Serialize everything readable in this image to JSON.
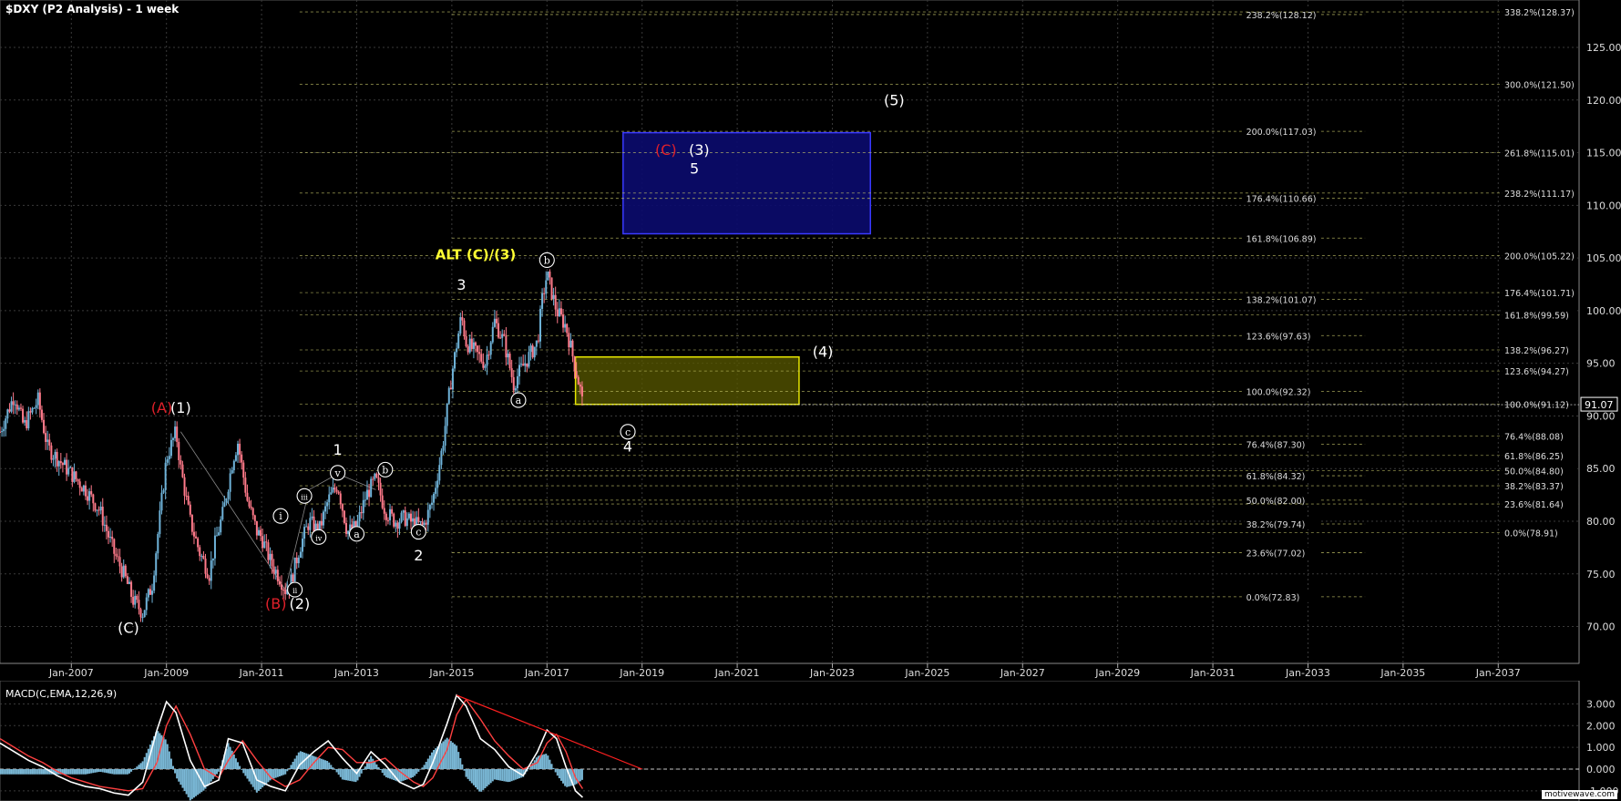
{
  "title": "$DXY (P2 Analysis) - 1 week",
  "macd_title": "MACD(C,EMA,12,26,9)",
  "watermark": "motivewave.com",
  "colors": {
    "background": "#000000",
    "grid": "#3a3a3a",
    "candle_up": "#6fb3d9",
    "candle_down": "#ff7a8a",
    "fib_line": "#c8c86a",
    "fib_label_bg": "#000000",
    "blue_box": "#0b0b6e",
    "blue_border": "#3a3aff",
    "yellow_box": "#5a5a00",
    "yellow_border": "#e6e600",
    "red_label": "#e0202a",
    "yellow_label": "#ffff33",
    "macd_line": "#ffffff",
    "signal_line": "#ff4040",
    "histogram": "#7ab8d6",
    "trendline": "#ff2020"
  },
  "chart_data": [
    {
      "type": "candlestick",
      "title": "$DXY (P2 Analysis) - 1 week",
      "x_ticks": [
        "Jan-2007",
        "Jan-2009",
        "Jan-2011",
        "Jan-2013",
        "Jan-2015",
        "Jan-2017",
        "Jan-2019",
        "Jan-2021",
        "Jan-2023",
        "Jan-2025",
        "Jan-2027",
        "Jan-2029",
        "Jan-2031",
        "Jan-2033",
        "Jan-2035",
        "Jan-2037"
      ],
      "x_range": [
        2005.5,
        2038.7
      ],
      "y_ticks": [
        70,
        75,
        80,
        85,
        90,
        95,
        100,
        105,
        110,
        115,
        120,
        125
      ],
      "y_tick_labels": [
        "70.00",
        "75.00",
        "80.00",
        "85.00",
        "90.00",
        "95.00",
        "100.00",
        "105.00",
        "110.00",
        "115.00",
        "120.00",
        "125.00"
      ],
      "y_range": [
        66.5,
        129.5
      ],
      "current_price": "91.07",
      "price_path": [
        [
          2005.5,
          88.5
        ],
        [
          2005.8,
          92
        ],
        [
          2006.0,
          89
        ],
        [
          2006.3,
          91.5
        ],
        [
          2006.5,
          87
        ],
        [
          2006.8,
          85.5
        ],
        [
          2007.0,
          84.5
        ],
        [
          2007.3,
          83
        ],
        [
          2007.6,
          81
        ],
        [
          2007.9,
          77
        ],
        [
          2008.1,
          75
        ],
        [
          2008.3,
          72.5
        ],
        [
          2008.5,
          71.3
        ],
        [
          2008.7,
          74
        ],
        [
          2008.9,
          82
        ],
        [
          2009.0,
          86
        ],
        [
          2009.2,
          88.5
        ],
        [
          2009.3,
          85
        ],
        [
          2009.5,
          80
        ],
        [
          2009.7,
          77
        ],
        [
          2009.9,
          75
        ],
        [
          2010.0,
          77.5
        ],
        [
          2010.2,
          81
        ],
        [
          2010.4,
          86
        ],
        [
          2010.5,
          87.5
        ],
        [
          2010.7,
          82
        ],
        [
          2010.9,
          79
        ],
        [
          2011.0,
          78.5
        ],
        [
          2011.2,
          76
        ],
        [
          2011.4,
          74.5
        ],
        [
          2011.5,
          73.5
        ],
        [
          2011.6,
          74
        ],
        [
          2011.8,
          77.5
        ],
        [
          2012.0,
          80
        ],
        [
          2012.2,
          79
        ],
        [
          2012.4,
          82
        ],
        [
          2012.6,
          83.5
        ],
        [
          2012.8,
          79
        ],
        [
          2013.0,
          79.5
        ],
        [
          2013.2,
          82.5
        ],
        [
          2013.4,
          84
        ],
        [
          2013.6,
          81
        ],
        [
          2013.8,
          80
        ],
        [
          2014.0,
          80.3
        ],
        [
          2014.2,
          79.8
        ],
        [
          2014.4,
          79.5
        ],
        [
          2014.6,
          82
        ],
        [
          2014.8,
          87
        ],
        [
          2015.0,
          94
        ],
        [
          2015.2,
          99.5
        ],
        [
          2015.3,
          97
        ],
        [
          2015.5,
          96
        ],
        [
          2015.7,
          95
        ],
        [
          2015.9,
          99
        ],
        [
          2016.1,
          97
        ],
        [
          2016.3,
          93
        ],
        [
          2016.4,
          94
        ],
        [
          2016.6,
          95.5
        ],
        [
          2016.8,
          97
        ],
        [
          2016.9,
          101
        ],
        [
          2017.0,
          103.5
        ],
        [
          2017.2,
          100
        ],
        [
          2017.4,
          98.5
        ],
        [
          2017.6,
          94.5
        ],
        [
          2017.7,
          92.5
        ],
        [
          2017.75,
          91.07
        ]
      ],
      "fib_left": [
        {
          "label": "238.2%(128.12)",
          "value": 128.12
        },
        {
          "label": "200.0%(117.03)",
          "value": 117.03
        },
        {
          "label": "176.4%(110.66)",
          "value": 110.66
        },
        {
          "label": "161.8%(106.89)",
          "value": 106.89
        },
        {
          "label": "138.2%(101.07)",
          "value": 101.07
        },
        {
          "label": "123.6%(97.63)",
          "value": 97.63
        },
        {
          "label": "100.0%(92.32)",
          "value": 92.32
        },
        {
          "label": "76.4%(87.30)",
          "value": 87.3
        },
        {
          "label": "61.8%(84.32)",
          "value": 84.32
        },
        {
          "label": "50.0%(82.00)",
          "value": 82.0
        },
        {
          "label": "38.2%(79.74)",
          "value": 79.74
        },
        {
          "label": "23.6%(77.02)",
          "value": 77.02
        },
        {
          "label": "0.0%(72.83)",
          "value": 72.83
        }
      ],
      "fib_right": [
        {
          "label": "338.2%(128.37)",
          "value": 128.37
        },
        {
          "label": "300.0%(121.50)",
          "value": 121.5
        },
        {
          "label": "261.8%(115.01)",
          "value": 115.01
        },
        {
          "label": "238.2%(111.17)",
          "value": 111.17
        },
        {
          "label": "200.0%(105.22)",
          "value": 105.22
        },
        {
          "label": "176.4%(101.71)",
          "value": 101.71
        },
        {
          "label": "161.8%(99.59)",
          "value": 99.59
        },
        {
          "label": "138.2%(96.27)",
          "value": 96.27
        },
        {
          "label": "123.6%(94.27)",
          "value": 94.27
        },
        {
          "label": "100.0%(91.12)",
          "value": 91.12
        },
        {
          "label": "76.4%(88.08)",
          "value": 88.08
        },
        {
          "label": "61.8%(86.25)",
          "value": 86.25
        },
        {
          "label": "50.0%(84.80)",
          "value": 84.8
        },
        {
          "label": "38.2%(83.37)",
          "value": 83.37
        },
        {
          "label": "23.6%(81.64)",
          "value": 81.64
        },
        {
          "label": "0.0%(78.91)",
          "value": 78.91
        }
      ],
      "target_boxes": [
        {
          "kind": "blue",
          "x": [
            2018.6,
            2023.8
          ],
          "y": [
            107.3,
            116.9
          ]
        },
        {
          "kind": "yellow",
          "x": [
            2017.6,
            2022.3
          ],
          "y": [
            91.1,
            95.6
          ]
        }
      ],
      "wave_labels": [
        {
          "text": "(A)",
          "x": 2008.9,
          "y": 90.3,
          "color": "red"
        },
        {
          "text": "(1)",
          "x": 2009.3,
          "y": 90.3,
          "color": "white"
        },
        {
          "text": "(B)",
          "x": 2011.3,
          "y": 71.7,
          "color": "red"
        },
        {
          "text": "(2)",
          "x": 2011.8,
          "y": 71.7,
          "color": "white"
        },
        {
          "text": "(C)",
          "x": 2008.2,
          "y": 69.4,
          "color": "white"
        },
        {
          "text": "1",
          "x": 2012.6,
          "y": 86.3,
          "color": "white"
        },
        {
          "text": "2",
          "x": 2014.3,
          "y": 76.3,
          "color": "white"
        },
        {
          "text": "3",
          "x": 2015.2,
          "y": 102.0,
          "color": "white"
        },
        {
          "text": "4",
          "x": 2018.7,
          "y": 86.6,
          "color": "white"
        },
        {
          "text": "(4)",
          "x": 2022.8,
          "y": 95.6,
          "color": "white"
        },
        {
          "text": "(5)",
          "x": 2024.3,
          "y": 119.5,
          "color": "white"
        },
        {
          "text": "(C)",
          "x": 2019.5,
          "y": 114.8,
          "color": "red"
        },
        {
          "text": "(3)",
          "x": 2020.2,
          "y": 114.8,
          "color": "white"
        },
        {
          "text": "5",
          "x": 2020.1,
          "y": 113.0,
          "color": "white"
        },
        {
          "text": "ALT (C)/(3)",
          "x": 2015.5,
          "y": 104.9,
          "color": "yellow"
        }
      ],
      "circled_labels": [
        {
          "text": "v",
          "x": 2012.6,
          "y": 84.6
        },
        {
          "text": "iii",
          "x": 2011.9,
          "y": 82.4
        },
        {
          "text": "i",
          "x": 2011.4,
          "y": 80.5
        },
        {
          "text": "iv",
          "x": 2012.2,
          "y": 78.5
        },
        {
          "text": "ii",
          "x": 2011.7,
          "y": 73.5
        },
        {
          "text": "a",
          "x": 2013.0,
          "y": 78.8
        },
        {
          "text": "b",
          "x": 2013.6,
          "y": 84.9
        },
        {
          "text": "c",
          "x": 2014.3,
          "y": 79.0
        },
        {
          "text": "a",
          "x": 2016.4,
          "y": 91.5
        },
        {
          "text": "b",
          "x": 2017.0,
          "y": 104.8
        },
        {
          "text": "c",
          "x": 2018.7,
          "y": 88.5
        }
      ]
    },
    {
      "type": "line",
      "title": "MACD(C,EMA,12,26,9)",
      "y_ticks": [
        3.0,
        2.0,
        1.0,
        0.0,
        -1.0
      ],
      "y_tick_labels": [
        "3.000",
        "2.000",
        "1.000",
        "0.000",
        "-1.000"
      ],
      "y_range": [
        -1.3,
        3.9
      ],
      "macd": [
        [
          2005.5,
          1.2
        ],
        [
          2005.8,
          0.8
        ],
        [
          2006.1,
          0.4
        ],
        [
          2006.4,
          0.1
        ],
        [
          2006.7,
          -0.3
        ],
        [
          2007.0,
          -0.6
        ],
        [
          2007.3,
          -0.8
        ],
        [
          2007.6,
          -0.9
        ],
        [
          2007.9,
          -1.1
        ],
        [
          2008.2,
          -1.2
        ],
        [
          2008.5,
          -0.6
        ],
        [
          2008.8,
          1.8
        ],
        [
          2009.0,
          3.1
        ],
        [
          2009.2,
          2.6
        ],
        [
          2009.5,
          0.4
        ],
        [
          2009.8,
          -0.8
        ],
        [
          2010.1,
          -0.5
        ],
        [
          2010.3,
          1.4
        ],
        [
          2010.6,
          1.2
        ],
        [
          2010.9,
          -0.5
        ],
        [
          2011.2,
          -0.8
        ],
        [
          2011.5,
          -1.0
        ],
        [
          2011.8,
          0.2
        ],
        [
          2012.1,
          0.8
        ],
        [
          2012.4,
          1.3
        ],
        [
          2012.7,
          0.5
        ],
        [
          2013.0,
          -0.2
        ],
        [
          2013.3,
          0.8
        ],
        [
          2013.6,
          0.2
        ],
        [
          2013.9,
          -0.6
        ],
        [
          2014.2,
          -0.9
        ],
        [
          2014.4,
          -0.7
        ],
        [
          2014.6,
          0.3
        ],
        [
          2014.9,
          2.1
        ],
        [
          2015.1,
          3.4
        ],
        [
          2015.3,
          2.9
        ],
        [
          2015.6,
          1.4
        ],
        [
          2015.9,
          0.9
        ],
        [
          2016.2,
          0.1
        ],
        [
          2016.5,
          -0.3
        ],
        [
          2016.8,
          0.8
        ],
        [
          2017.0,
          1.8
        ],
        [
          2017.2,
          1.4
        ],
        [
          2017.4,
          0.1
        ],
        [
          2017.6,
          -1.0
        ],
        [
          2017.75,
          -1.3
        ]
      ],
      "signal": [
        [
          2005.5,
          1.4
        ],
        [
          2005.8,
          1.0
        ],
        [
          2006.1,
          0.6
        ],
        [
          2006.4,
          0.3
        ],
        [
          2006.7,
          -0.1
        ],
        [
          2007.0,
          -0.4
        ],
        [
          2007.3,
          -0.6
        ],
        [
          2007.6,
          -0.8
        ],
        [
          2007.9,
          -0.9
        ],
        [
          2008.2,
          -1.0
        ],
        [
          2008.5,
          -0.9
        ],
        [
          2008.8,
          0.3
        ],
        [
          2009.0,
          2.0
        ],
        [
          2009.2,
          2.9
        ],
        [
          2009.5,
          1.6
        ],
        [
          2009.8,
          0.0
        ],
        [
          2010.1,
          -0.4
        ],
        [
          2010.3,
          0.4
        ],
        [
          2010.6,
          1.3
        ],
        [
          2010.9,
          0.4
        ],
        [
          2011.2,
          -0.4
        ],
        [
          2011.5,
          -0.8
        ],
        [
          2011.8,
          -0.5
        ],
        [
          2012.1,
          0.3
        ],
        [
          2012.4,
          1.0
        ],
        [
          2012.7,
          0.9
        ],
        [
          2013.0,
          0.3
        ],
        [
          2013.3,
          0.3
        ],
        [
          2013.6,
          0.5
        ],
        [
          2013.9,
          -0.1
        ],
        [
          2014.2,
          -0.6
        ],
        [
          2014.4,
          -0.8
        ],
        [
          2014.6,
          -0.4
        ],
        [
          2014.9,
          0.9
        ],
        [
          2015.1,
          2.5
        ],
        [
          2015.3,
          3.2
        ],
        [
          2015.6,
          2.3
        ],
        [
          2015.9,
          1.3
        ],
        [
          2016.2,
          0.6
        ],
        [
          2016.5,
          0.0
        ],
        [
          2016.8,
          0.3
        ],
        [
          2017.0,
          1.2
        ],
        [
          2017.2,
          1.6
        ],
        [
          2017.4,
          0.8
        ],
        [
          2017.6,
          -0.4
        ],
        [
          2017.75,
          -0.9
        ]
      ],
      "trendline": [
        [
          2015.1,
          3.4
        ],
        [
          2019.0,
          0.0
        ]
      ]
    }
  ]
}
